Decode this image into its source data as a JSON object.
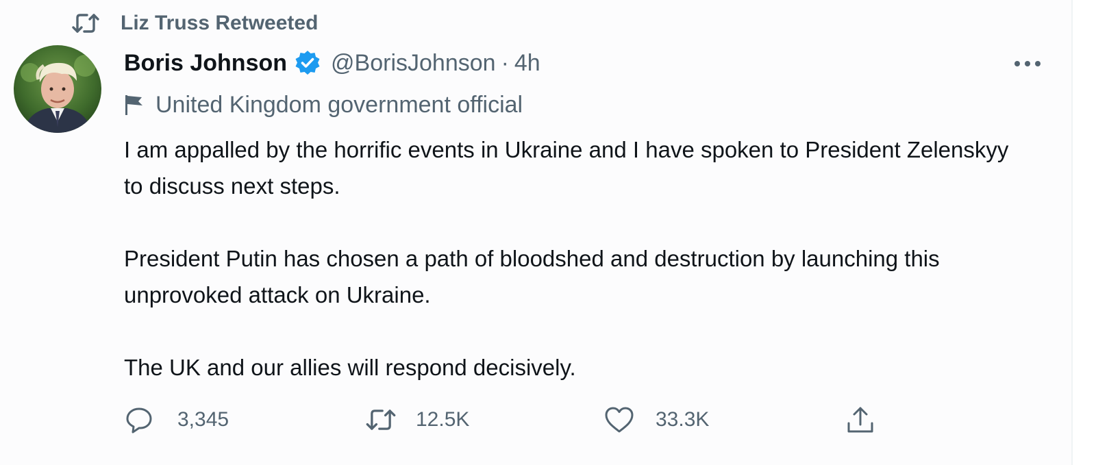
{
  "retweet_context": {
    "text": "Liz Truss Retweeted",
    "icon": "retweet-icon"
  },
  "tweet": {
    "author_name": "Boris Johnson",
    "verified": true,
    "handle": "@BorisJohnson",
    "separator": "·",
    "time": "4h",
    "label": "United Kingdom government official",
    "label_icon": "flag-icon",
    "paragraphs": [
      "I am appalled by the horrific events in Ukraine and I have spoken to President Zelenskyy to discuss next steps.",
      "President Putin has chosen a path of bloodshed and destruction by launching this unprovoked attack on Ukraine.",
      "The UK and our allies will respond decisively."
    ]
  },
  "actions": {
    "reply_count": "3,345",
    "retweet_count": "12.5K",
    "like_count": "33.3K",
    "icons": [
      "reply-icon",
      "retweet-icon",
      "like-icon",
      "share-icon"
    ]
  },
  "colors": {
    "verified_blue": "#1d9bf0",
    "secondary_text": "#536471",
    "primary_text": "#0f1419"
  }
}
